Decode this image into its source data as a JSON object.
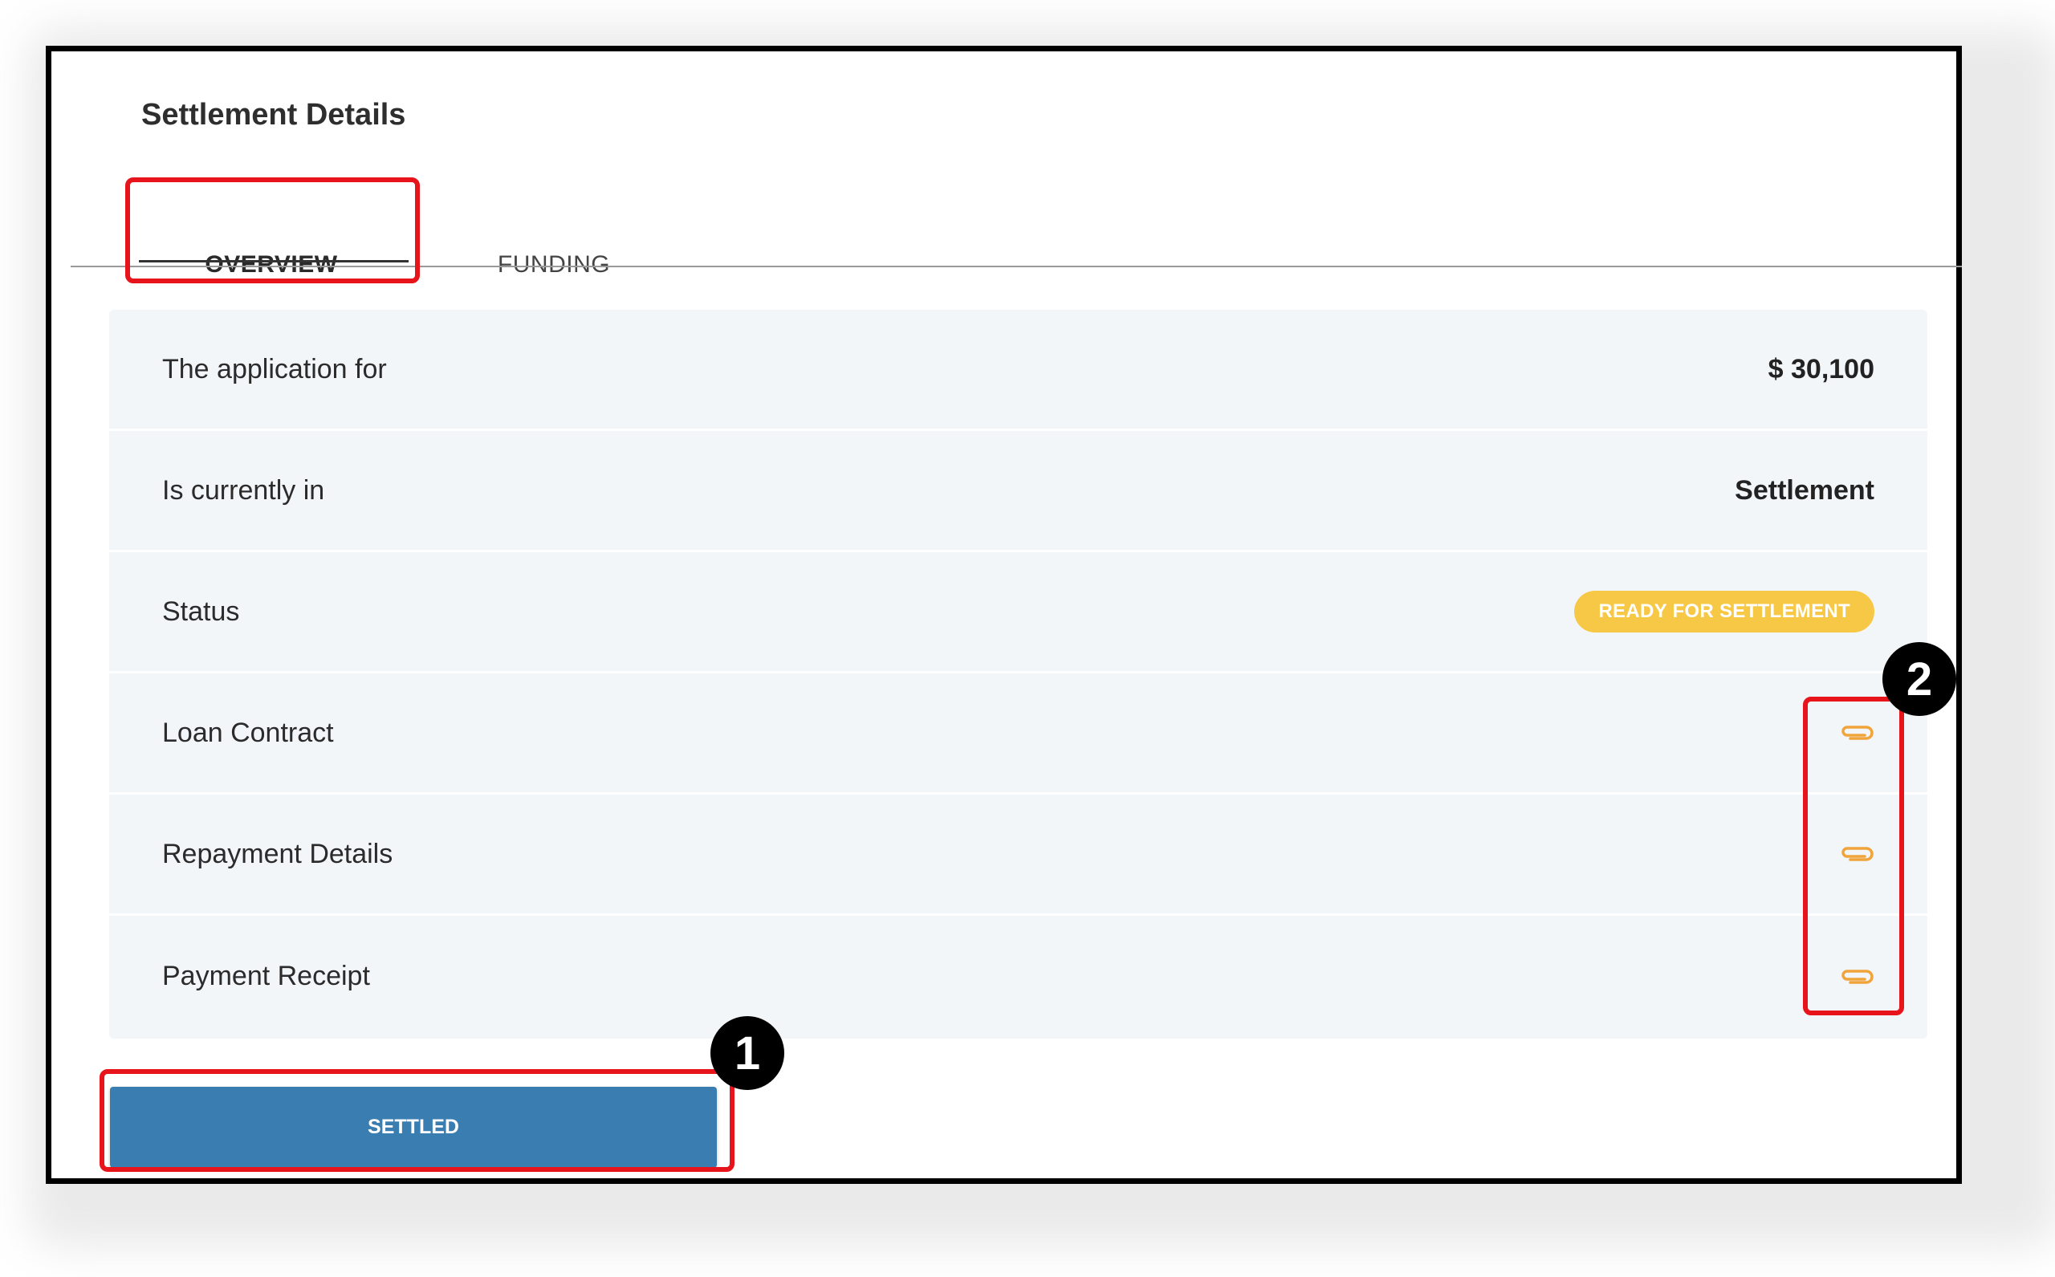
{
  "header": {
    "title": "Settlement Details"
  },
  "tabs": [
    {
      "label": "OVERVIEW"
    },
    {
      "label": "FUNDING"
    }
  ],
  "overview": {
    "rows": [
      {
        "label": "The application for",
        "value": "$ 30,100"
      },
      {
        "label": "Is currently in",
        "value": "Settlement"
      },
      {
        "label": "Status",
        "badge": "READY FOR SETTLEMENT"
      },
      {
        "label": "Loan Contract",
        "icon": "paperclip-icon"
      },
      {
        "label": "Repayment Details",
        "icon": "paperclip-icon"
      },
      {
        "label": "Payment Receipt",
        "icon": "paperclip-icon"
      }
    ]
  },
  "actions": {
    "settled_label": "SETTLED"
  },
  "annotations": {
    "callout_1": "1",
    "callout_2": "2"
  },
  "colors": {
    "badge": "#f7c846",
    "button": "#3a7db0",
    "icon": "#f0a43a",
    "highlight": "#e8141c",
    "panel": "#f3f6f9"
  }
}
